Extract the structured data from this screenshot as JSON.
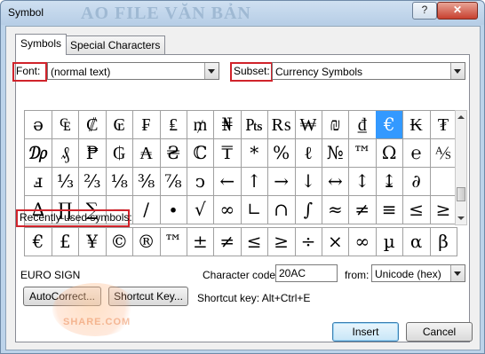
{
  "window": {
    "title": "Symbol",
    "title_watermark": "AO FILE VĂN BẢN",
    "help_label": "?",
    "close_label": "✕"
  },
  "tabs": [
    {
      "label": "Symbols",
      "active": true
    },
    {
      "label": "Special Characters",
      "active": false
    }
  ],
  "font": {
    "label": "Font:",
    "value": "(normal text)"
  },
  "subset": {
    "label": "Subset:",
    "value": "Currency Symbols"
  },
  "symbol_rows": [
    [
      "ə",
      "₠",
      "₡",
      "₢",
      "₣",
      "₤",
      "₥",
      "₦",
      "₧",
      "₨",
      "₩",
      "₪",
      "₫",
      "€",
      "₭",
      "₮"
    ],
    [
      "₯",
      "₰",
      "₱",
      "₲",
      "₳",
      "₴",
      "ℂ",
      "₸",
      "*",
      "%",
      "ℓ",
      "№",
      "™",
      "Ω",
      "℮",
      "⅍"
    ],
    [
      "ⅎ",
      "⅓",
      "⅔",
      "⅛",
      "⅜",
      "⅞",
      "ↄ",
      "←",
      "↑",
      "→",
      "↓",
      "↔",
      "↕",
      "↨",
      "∂",
      " "
    ],
    [
      "∆",
      "∏",
      "∑",
      "−",
      "∕",
      "∙",
      "√",
      "∞",
      "∟",
      "∩",
      "∫",
      "≈",
      "≠",
      "≡",
      "≤",
      "≥"
    ]
  ],
  "selected_symbol": "€",
  "recent": {
    "label": "Recently used symbols:",
    "symbols": [
      "€",
      "£",
      "¥",
      "©",
      "®",
      "™",
      "±",
      "≠",
      "≤",
      "≥",
      "÷",
      "×",
      "∞",
      "µ",
      "α",
      "β"
    ]
  },
  "char_name": "EURO SIGN",
  "char_code": {
    "label": "Character code:",
    "value": "20AC"
  },
  "from": {
    "label": "from:",
    "value": "Unicode (hex)"
  },
  "autocorrect_label": "AutoCorrect...",
  "shortcut_key_label": "Shortcut Key...",
  "shortcut_text": "Shortcut key: Alt+Ctrl+E",
  "insert_label": "Insert",
  "cancel_label": "Cancel",
  "logo_text": "SHARE.COM",
  "colors": {
    "selection": "#3399ff",
    "highlight_box": "#d0232b",
    "title_bar": "#bcd3ea"
  }
}
